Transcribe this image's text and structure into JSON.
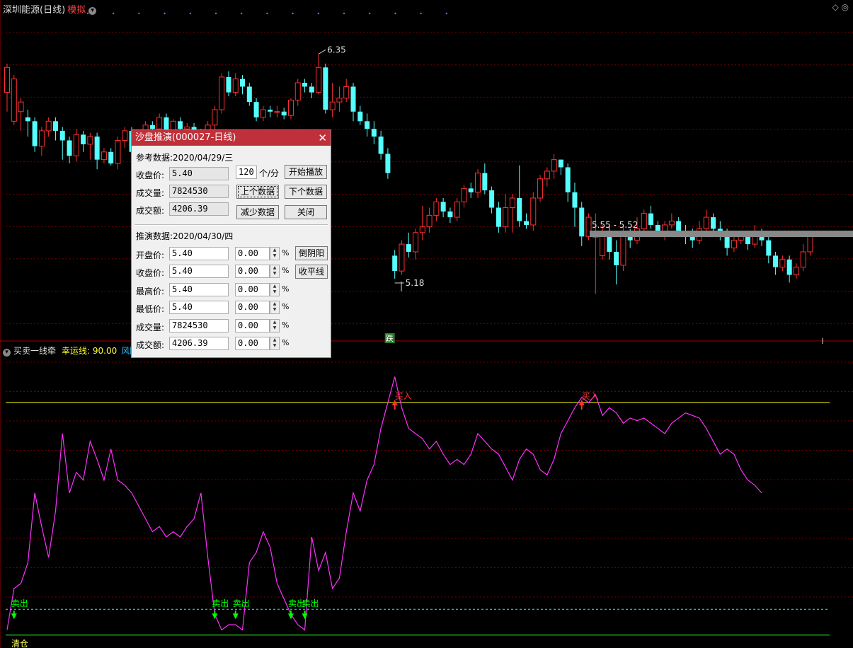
{
  "header": {
    "stock": "深圳能源(日线)",
    "mode": "模拟"
  },
  "price": {
    "high_label": "6.35",
    "low_label": "5.18",
    "range_label": "5.55 - 5.52",
    "low_badge": "跌",
    "ylim": [
      4.9,
      6.55
    ],
    "candles": [
      [
        6.15,
        6.28,
        6.05,
        6.3
      ],
      [
        6.0,
        6.22,
        5.98,
        6.24
      ],
      [
        6.05,
        6.1,
        5.95,
        6.12
      ],
      [
        6.02,
        6.0,
        5.92,
        6.06
      ],
      [
        6.0,
        5.87,
        5.84,
        6.02
      ],
      [
        5.87,
        5.95,
        5.82,
        5.97
      ],
      [
        5.95,
        6.0,
        5.92,
        6.02
      ],
      [
        6.0,
        5.95,
        5.9,
        6.02
      ],
      [
        5.95,
        5.9,
        5.8,
        5.97
      ],
      [
        5.9,
        5.82,
        5.78,
        5.92
      ],
      [
        5.82,
        5.93,
        5.79,
        5.96
      ],
      [
        5.93,
        5.88,
        5.84,
        5.95
      ],
      [
        5.88,
        5.92,
        5.8,
        5.94
      ],
      [
        5.92,
        5.8,
        5.75,
        5.94
      ],
      [
        5.8,
        5.84,
        5.78,
        5.86
      ],
      [
        5.84,
        5.78,
        5.77,
        5.86
      ],
      [
        5.78,
        5.9,
        5.75,
        5.92
      ],
      [
        5.9,
        5.95,
        5.86,
        5.97
      ],
      [
        5.95,
        5.84,
        5.82,
        5.97
      ],
      [
        5.84,
        5.87,
        5.8,
        5.9
      ],
      [
        5.87,
        5.98,
        5.84,
        6.0
      ],
      [
        5.98,
        5.96,
        5.94,
        6.0
      ],
      [
        5.96,
        6.02,
        5.92,
        6.04
      ],
      [
        6.02,
        5.95,
        5.93,
        6.04
      ],
      [
        5.95,
        6.0,
        5.93,
        6.01
      ],
      [
        6.0,
        5.96,
        5.94,
        6.02
      ],
      [
        5.96,
        5.97,
        5.9,
        5.99
      ],
      [
        5.97,
        5.94,
        5.92,
        5.99
      ],
      [
        5.94,
        5.88,
        5.86,
        5.96
      ],
      [
        5.88,
        5.98,
        5.86,
        6.0
      ],
      [
        5.98,
        6.06,
        5.95,
        6.08
      ],
      [
        6.06,
        6.23,
        6.04,
        6.25
      ],
      [
        6.23,
        6.15,
        6.13,
        6.26
      ],
      [
        6.15,
        6.22,
        6.13,
        6.25
      ],
      [
        6.22,
        6.18,
        6.14,
        6.24
      ],
      [
        6.18,
        6.1,
        6.08,
        6.2
      ],
      [
        6.1,
        6.02,
        6.0,
        6.12
      ],
      [
        6.02,
        6.06,
        6.0,
        6.08
      ],
      [
        6.06,
        6.05,
        6.02,
        6.08
      ],
      [
        6.05,
        6.05,
        6.02,
        6.08
      ],
      [
        6.05,
        6.03,
        6.01,
        6.07
      ],
      [
        6.03,
        6.11,
        6.01,
        6.12
      ],
      [
        6.11,
        6.2,
        6.08,
        6.22
      ],
      [
        6.2,
        6.18,
        6.15,
        6.22
      ],
      [
        6.18,
        6.15,
        6.12,
        6.2
      ],
      [
        6.15,
        6.28,
        6.14,
        6.35
      ],
      [
        6.28,
        6.06,
        6.04,
        6.3
      ],
      [
        6.06,
        6.1,
        6.02,
        6.2
      ],
      [
        6.1,
        6.12,
        6.05,
        6.18
      ],
      [
        6.12,
        6.18,
        6.1,
        6.22
      ],
      [
        6.18,
        6.05,
        6.0,
        6.2
      ],
      [
        6.05,
        6.0,
        5.98,
        6.08
      ],
      [
        6.0,
        5.96,
        5.92,
        6.04
      ],
      [
        5.96,
        5.92,
        5.88,
        6.0
      ],
      [
        5.92,
        5.83,
        5.8,
        5.95
      ],
      [
        5.83,
        5.73,
        5.7,
        5.86
      ],
      [
        5.3,
        5.22,
        5.18,
        5.33
      ],
      [
        5.22,
        5.36,
        5.2,
        5.38
      ],
      [
        5.36,
        5.32,
        5.29,
        5.42
      ],
      [
        5.32,
        5.42,
        5.28,
        5.44
      ],
      [
        5.42,
        5.45,
        5.38,
        5.56
      ],
      [
        5.45,
        5.51,
        5.42,
        5.55
      ],
      [
        5.51,
        5.58,
        5.48,
        5.6
      ],
      [
        5.58,
        5.53,
        5.5,
        5.6
      ],
      [
        5.53,
        5.5,
        5.47,
        5.55
      ],
      [
        5.5,
        5.58,
        5.48,
        5.6
      ],
      [
        5.58,
        5.65,
        5.55,
        5.67
      ],
      [
        5.65,
        5.63,
        5.6,
        5.68
      ],
      [
        5.63,
        5.73,
        5.6,
        5.75
      ],
      [
        5.73,
        5.64,
        5.62,
        5.78
      ],
      [
        5.64,
        5.55,
        5.52,
        5.66
      ],
      [
        5.55,
        5.45,
        5.42,
        5.58
      ],
      [
        5.45,
        5.55,
        5.42,
        5.62
      ],
      [
        5.55,
        5.6,
        5.42,
        5.62
      ],
      [
        5.6,
        5.48,
        5.45,
        5.77
      ],
      [
        5.48,
        5.46,
        5.44,
        5.52
      ],
      [
        5.46,
        5.6,
        5.43,
        5.63
      ],
      [
        5.6,
        5.7,
        5.58,
        5.72
      ],
      [
        5.7,
        5.74,
        5.66,
        5.76
      ],
      [
        5.74,
        5.8,
        5.7,
        5.83
      ],
      [
        5.8,
        5.76,
        5.72,
        5.8
      ],
      [
        5.76,
        5.63,
        5.58,
        5.78
      ],
      [
        5.63,
        5.55,
        5.45,
        5.68
      ],
      [
        5.55,
        5.4,
        5.35,
        5.58
      ],
      [
        5.4,
        5.5,
        5.38,
        5.52
      ],
      [
        5.4,
        5.4,
        5.1,
        5.52
      ],
      [
        5.3,
        5.4,
        5.28,
        5.46
      ],
      [
        5.4,
        5.32,
        5.28,
        5.46
      ],
      [
        5.32,
        5.25,
        5.15,
        5.38
      ],
      [
        5.25,
        5.4,
        5.22,
        5.45
      ],
      [
        5.4,
        5.38,
        5.34,
        5.44
      ],
      [
        5.38,
        5.44,
        5.36,
        5.5
      ],
      [
        5.44,
        5.52,
        5.42,
        5.54
      ],
      [
        5.52,
        5.46,
        5.44,
        5.56
      ],
      [
        5.46,
        5.42,
        5.4,
        5.48
      ],
      [
        5.42,
        5.46,
        5.38,
        5.48
      ],
      [
        5.46,
        5.48,
        5.44,
        5.52
      ],
      [
        5.48,
        5.43,
        5.4,
        5.5
      ],
      [
        5.43,
        5.4,
        5.36,
        5.46
      ],
      [
        5.4,
        5.38,
        5.34,
        5.44
      ],
      [
        5.38,
        5.44,
        5.36,
        5.48
      ],
      [
        5.44,
        5.5,
        5.42,
        5.54
      ],
      [
        5.5,
        5.44,
        5.4,
        5.52
      ],
      [
        5.44,
        5.4,
        5.38,
        5.48
      ],
      [
        5.4,
        5.34,
        5.3,
        5.44
      ],
      [
        5.34,
        5.38,
        5.32,
        5.4
      ],
      [
        5.38,
        5.4,
        5.36,
        5.42
      ],
      [
        5.4,
        5.36,
        5.33,
        5.42
      ],
      [
        5.36,
        5.42,
        5.34,
        5.46
      ],
      [
        5.42,
        5.38,
        5.35,
        5.44
      ],
      [
        5.38,
        5.3,
        5.26,
        5.4
      ],
      [
        5.3,
        5.24,
        5.2,
        5.32
      ],
      [
        5.24,
        5.28,
        5.22,
        5.3
      ],
      [
        5.28,
        5.2,
        5.16,
        5.3
      ],
      [
        5.2,
        5.24,
        5.18,
        5.26
      ],
      [
        5.24,
        5.32,
        5.22,
        5.36
      ],
      [
        5.32,
        5.4,
        5.3,
        5.42
      ]
    ]
  },
  "indicator": {
    "name": "买卖一线牵",
    "luck_label": "幸运线: 90.00",
    "risk_label": "风险",
    "ylim": [
      -5,
      110
    ],
    "upper_line": 90,
    "lower_line": 10,
    "zero_line": 0,
    "values": [
      2,
      18,
      20,
      28,
      55,
      42,
      30,
      48,
      78,
      55,
      63,
      60,
      75,
      68,
      60,
      72,
      60,
      58,
      55,
      50,
      45,
      40,
      42,
      38,
      40,
      38,
      42,
      45,
      55,
      30,
      8,
      2,
      4,
      4,
      2,
      28,
      32,
      40,
      34,
      20,
      14,
      8,
      4,
      2,
      38,
      25,
      32,
      18,
      22,
      40,
      55,
      48,
      60,
      66,
      80,
      90,
      100,
      88,
      80,
      78,
      76,
      72,
      75,
      70,
      66,
      68,
      66,
      70,
      78,
      75,
      72,
      70,
      65,
      60,
      68,
      72,
      70,
      64,
      62,
      68,
      78,
      83,
      88,
      92,
      90,
      93,
      85,
      88,
      86,
      82,
      84,
      83,
      84,
      82,
      80,
      78,
      82,
      84,
      86,
      85,
      84,
      80,
      75,
      70,
      72,
      70,
      64,
      60,
      58,
      55
    ],
    "sell_signals": [
      {
        "i": 1,
        "label": "卖出"
      },
      {
        "i": 30,
        "label": "卖出"
      },
      {
        "i": 33,
        "label": "卖出"
      },
      {
        "i": 41,
        "label": "卖出"
      },
      {
        "i": 43,
        "label": "卖出"
      }
    ],
    "buy_signals": [
      {
        "i": 56,
        "label": "买入"
      },
      {
        "i": 83,
        "label": "买入"
      }
    ],
    "clear_label": "清仓"
  },
  "dialog": {
    "title": "沙盘推演(000027-日线)",
    "ref_date": "参考数据:2020/04/29/三",
    "ref": [
      {
        "label": "收盘价:",
        "value": "5.40"
      },
      {
        "label": "成交量:",
        "value": "7824530"
      },
      {
        "label": "成交额:",
        "value": "4206.39"
      }
    ],
    "speed": "120",
    "speed_unit": "个/分",
    "btn_play": "开始播放",
    "btn_prev": "上个数据",
    "btn_next": "下个数据",
    "btn_reduce": "减少数据",
    "btn_close": "关闭",
    "sim_date": "推演数据:2020/04/30/四",
    "sim": [
      {
        "label": "开盘价:",
        "value": "5.40",
        "pct": "0.00"
      },
      {
        "label": "收盘价:",
        "value": "5.40",
        "pct": "0.00"
      },
      {
        "label": "最高价:",
        "value": "5.40",
        "pct": "0.00"
      },
      {
        "label": "最低价:",
        "value": "5.40",
        "pct": "0.00"
      },
      {
        "label": "成交量:",
        "value": "7824530",
        "pct": "0.00"
      },
      {
        "label": "成交额:",
        "value": "4206.39",
        "pct": "0.00"
      }
    ],
    "pct_sign": "%",
    "btn_invert": "倒阴阳",
    "btn_flat": "收平线"
  },
  "colors": {
    "up": "#ff3030",
    "down": "#55ffff",
    "line": "#ff30ff",
    "yellow": "#ffff00",
    "grid": "#7a0000",
    "sell": "#00ff00",
    "buy": "#ff3030"
  }
}
